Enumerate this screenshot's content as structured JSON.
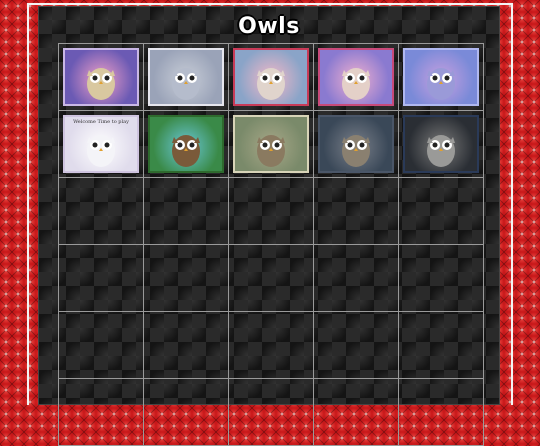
{
  "page": {
    "title": "Owls"
  },
  "tiles": [
    {
      "label": "owl-tube-1",
      "bg": "#6b5ab4",
      "frame": "#c9b7e6",
      "accent": "#f0a0c8",
      "body": "#d9c8a0",
      "caption": ""
    },
    {
      "label": "owl-tube-2",
      "bg": "#9aa3b8",
      "frame": "#e6e6ee",
      "accent": "#c9ced8",
      "body": "#b5bccc",
      "caption": ""
    },
    {
      "label": "owl-tube-3",
      "bg": "#8aa4c8",
      "frame": "#c83b58",
      "accent": "#f4b8c8",
      "body": "#e0d4cc",
      "caption": ""
    },
    {
      "label": "owl-tube-4",
      "bg": "#8a7ad0",
      "frame": "#c84a7a",
      "accent": "#f0b0d0",
      "body": "#e4d0c8",
      "caption": ""
    },
    {
      "label": "owl-tube-5",
      "bg": "#7a8ad8",
      "frame": "#b0b8f0",
      "accent": "#c8a0e0",
      "body": "#9a9ad8",
      "caption": ""
    },
    {
      "label": "owl-tube-6",
      "bg": "#e0dcec",
      "frame": "#cfc4e0",
      "accent": "#ffffff",
      "body": "#f4f4f8",
      "caption": "Welcome Time to play"
    },
    {
      "label": "owl-tube-7",
      "bg": "#3a8a48",
      "frame": "#2e6a2e",
      "accent": "#6ac8d8",
      "body": "#7a5a3a",
      "caption": ""
    },
    {
      "label": "owl-tube-8",
      "bg": "#7a8a6a",
      "frame": "#d8d4b8",
      "accent": "#a8a888",
      "body": "#8a7a60",
      "caption": ""
    },
    {
      "label": "owl-tube-9",
      "bg": "#3a4858",
      "frame": "#4a5668",
      "accent": "#7a808a",
      "body": "#8a8070",
      "caption": ""
    },
    {
      "label": "owl-tube-10",
      "bg": "#2a2e34",
      "frame": "#2a3a58",
      "accent": "#7a7a7a",
      "body": "#9a9a98",
      "caption": ""
    }
  ],
  "grid": {
    "rows": 6,
    "cols": 5
  }
}
